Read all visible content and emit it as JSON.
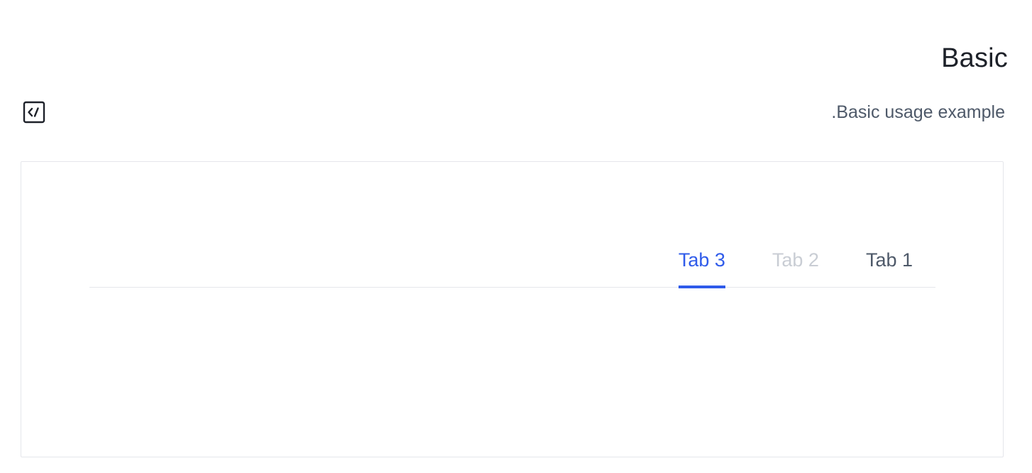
{
  "section": {
    "title": "Basic",
    "description": ".Basic usage example",
    "code_toggle_icon": "code-icon"
  },
  "tabs": {
    "items": [
      {
        "label": "Tab 1",
        "state": "default"
      },
      {
        "label": "Tab 2",
        "state": "disabled"
      },
      {
        "label": "Tab 3",
        "state": "active"
      }
    ]
  },
  "colors": {
    "accent": "#2f5bea",
    "text": "#4e5969",
    "title": "#1d2129",
    "disabled": "#c9cdd4",
    "border": "#e5e6eb"
  }
}
